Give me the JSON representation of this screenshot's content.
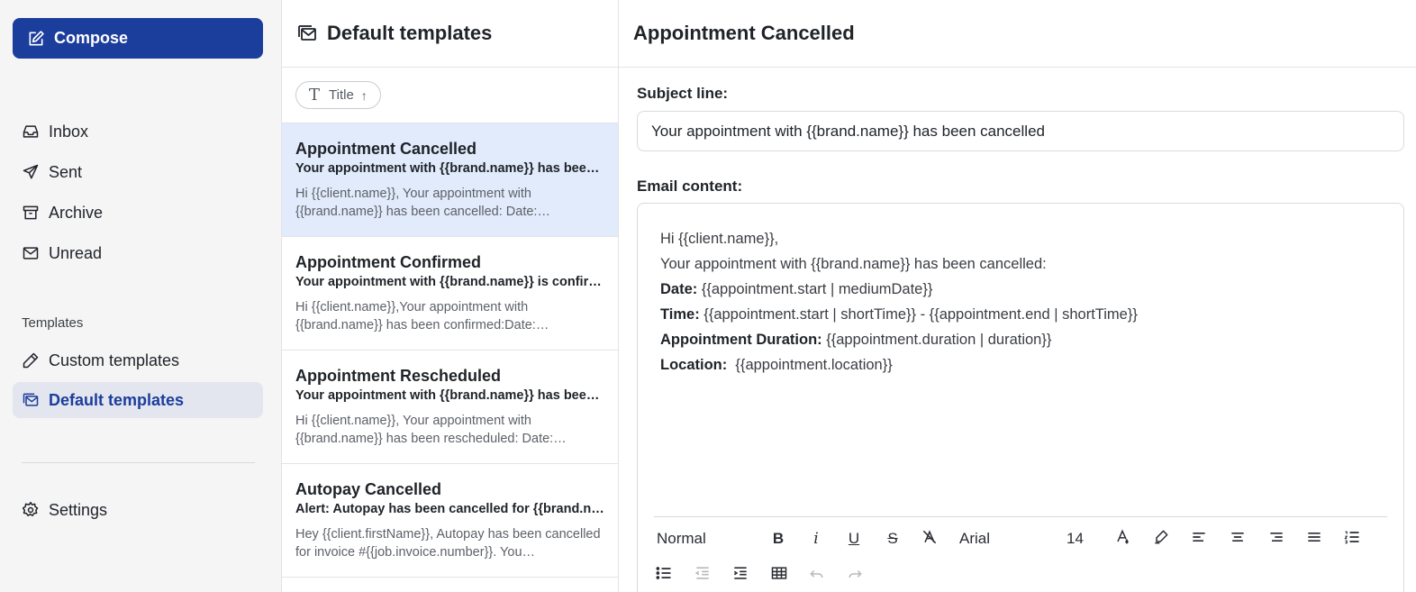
{
  "sidebar": {
    "compose_label": "Compose",
    "nav": [
      {
        "label": "Inbox",
        "icon": "inbox-icon"
      },
      {
        "label": "Sent",
        "icon": "send-icon"
      },
      {
        "label": "Archive",
        "icon": "archive-icon"
      },
      {
        "label": "Unread",
        "icon": "mail-icon"
      }
    ],
    "templates_section": "Templates",
    "templates_nav": [
      {
        "label": "Custom templates",
        "icon": "pen-icon"
      },
      {
        "label": "Default templates",
        "icon": "mail-stack-icon",
        "active": true
      }
    ],
    "settings_label": "Settings"
  },
  "list": {
    "title": "Default templates",
    "sort": {
      "label": "Title",
      "direction": "ascending"
    },
    "items": [
      {
        "name": "Appointment Cancelled",
        "subject": "Your appointment with {{brand.name}} has been …",
        "preview": "Hi {{client.name}}, Your appointment with {{brand.name}} has been cancelled: Date:…",
        "selected": true
      },
      {
        "name": "Appointment Confirmed",
        "subject": "Your appointment with {{brand.name}} is confir…",
        "preview": "Hi {{client.name}},Your appointment with {{brand.name}} has been confirmed:Date:…"
      },
      {
        "name": "Appointment Rescheduled",
        "subject": "Your appointment with {{brand.name}} has been …",
        "preview": "Hi {{client.name}}, Your appointment with {{brand.name}} has been rescheduled: Date:…"
      },
      {
        "name": "Autopay Cancelled",
        "subject": "Alert: Autopay has been cancelled for {{brand.na…",
        "preview": "Hey {{client.firstName}}, Autopay has been cancelled for invoice #{{job.invoice.number}}. You…"
      }
    ]
  },
  "detail": {
    "title": "Appointment Cancelled",
    "subject_label": "Subject line:",
    "subject_value": "Your appointment with {{brand.name}} has been cancelled",
    "content_label": "Email content:",
    "content": {
      "greeting": "Hi {{client.name}},",
      "intro": "Your appointment with {{brand.name}} has been cancelled:",
      "date_label": "Date:",
      "date_value": " {{appointment.start | mediumDate}}",
      "time_label": "Time:",
      "time_value": " {{appointment.start | shortTime}} - {{appointment.end | shortTime}}",
      "duration_label": "Appointment Duration:",
      "duration_value": " {{appointment.duration | duration}}",
      "location_label": "Location:",
      "location_value": "  {{appointment.location}}"
    },
    "toolbar": {
      "style": "Normal",
      "font": "Arial",
      "size": "14"
    }
  },
  "colors": {
    "primary": "#1b3d9c",
    "selected_row": "#e1ebfb",
    "sidebar_bg": "#f5f5f6"
  }
}
